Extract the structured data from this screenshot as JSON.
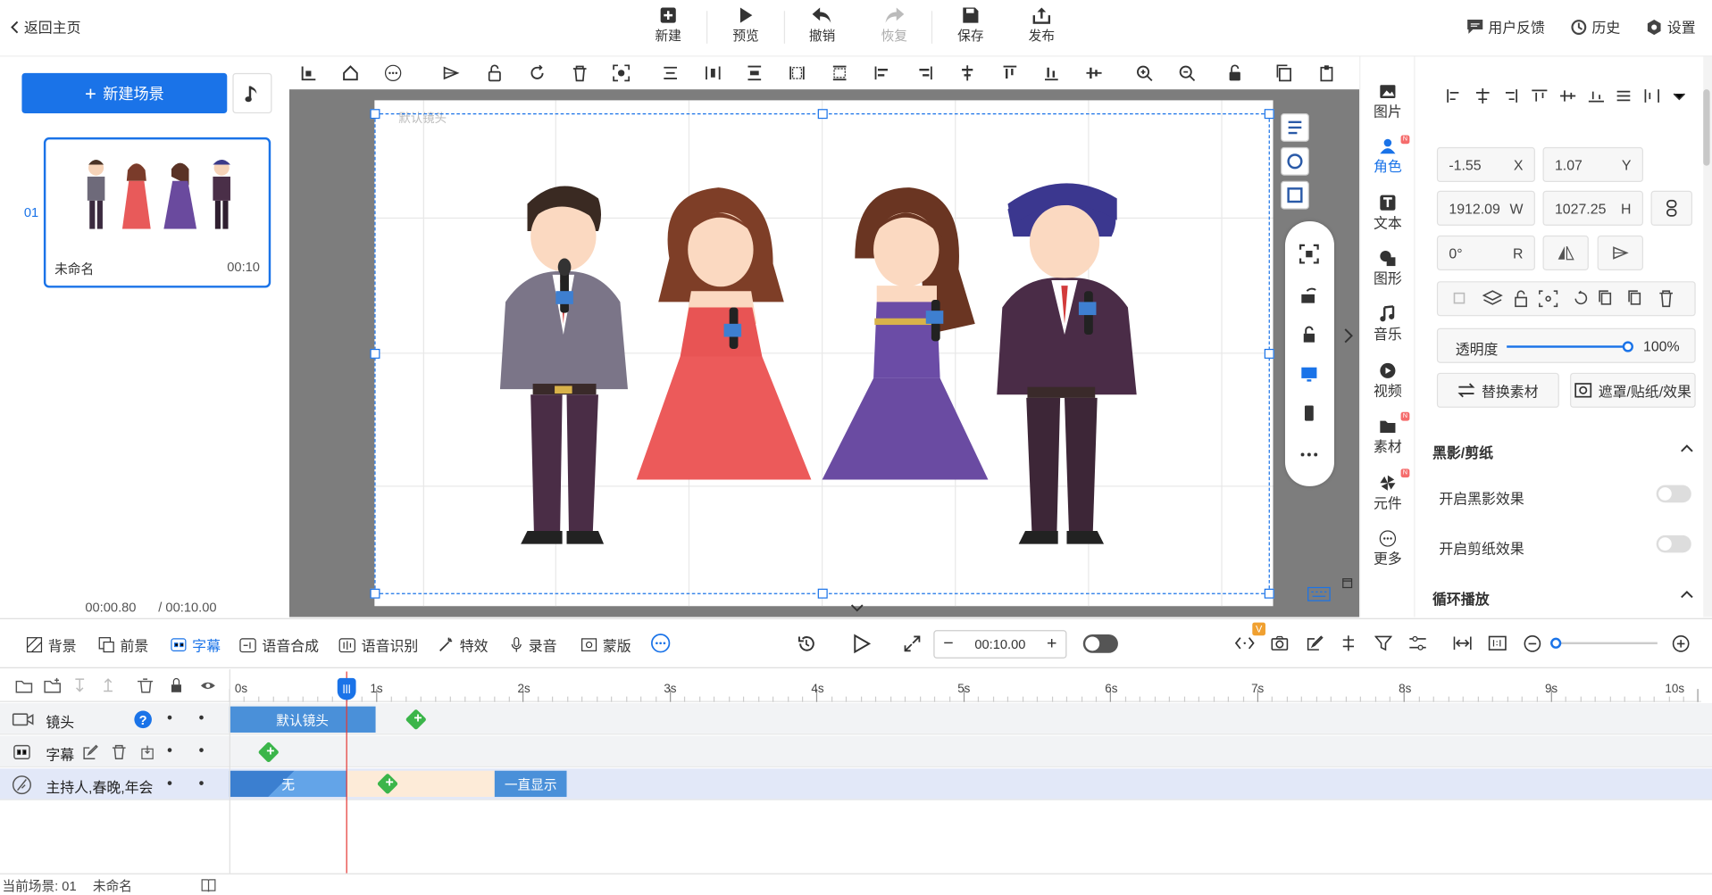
{
  "topbar": {
    "back_label": "返回主页",
    "new_label": "新建",
    "preview_label": "预览",
    "undo_label": "撤销",
    "redo_label": "恢复",
    "save_label": "保存",
    "publish_label": "发布",
    "feedback_label": "用户反馈",
    "history_label": "历史",
    "settings_label": "设置"
  },
  "left": {
    "new_scene_label": "新建场景",
    "scene_index": "01",
    "scene_name": "未命名",
    "scene_duration": "00:10",
    "current_time": "00:00.80",
    "total_time": "/ 00:10.00"
  },
  "canvas": {
    "camera_label": "默认镜头"
  },
  "rnav": {
    "items": [
      {
        "label": "图片",
        "icon": "image-icon"
      },
      {
        "label": "角色",
        "icon": "person-icon"
      },
      {
        "label": "文本",
        "icon": "text-icon"
      },
      {
        "label": "图形",
        "icon": "shape-icon"
      },
      {
        "label": "音乐",
        "icon": "music-icon"
      },
      {
        "label": "视频",
        "icon": "video-icon"
      },
      {
        "label": "素材",
        "icon": "folder-icon"
      },
      {
        "label": "元件",
        "icon": "pinwheel-icon"
      },
      {
        "label": "更多",
        "icon": "more-icon"
      }
    ],
    "badge": "N"
  },
  "props": {
    "x_value": "-1.55",
    "x_label": "X",
    "y_value": "1.07",
    "y_label": "Y",
    "w_value": "1912.09",
    "w_label": "W",
    "h_value": "1027.25",
    "h_label": "H",
    "r_value": "0°",
    "r_label": "R",
    "opacity_label": "透明度",
    "opacity_value": "100%",
    "opacity_level": 1.0,
    "replace_label": "替换素材",
    "mask_label": "遮罩/贴纸/效果",
    "section_shadow": "黑影/剪纸",
    "shadow_toggle_label": "开启黑影效果",
    "paper_toggle_label": "开启剪纸效果",
    "section_loop": "循环播放"
  },
  "timeline_toolbar": {
    "bg": "背景",
    "fg": "前景",
    "subtitle": "字幕",
    "tts": "语音合成",
    "asr": "语音识别",
    "effects": "特效",
    "record": "录音",
    "mask": "蒙版",
    "time": "00:10.00",
    "vip_badge": "V"
  },
  "ruler": [
    "0s",
    "1s",
    "2s",
    "3s",
    "4s",
    "5s",
    "6s",
    "7s",
    "8s",
    "9s",
    "10s"
  ],
  "tracks": {
    "camera_name": "镜头",
    "camera_clip": "默认镜头",
    "subtitle_name": "字幕",
    "role_name": "主持人,春晚,年会",
    "role_clip_a": "无",
    "role_clip_b": "一直显示"
  },
  "status": {
    "current_scene": "当前场景: 01",
    "scene_name": "未命名"
  },
  "colors": {
    "accent": "#1a73e8",
    "keyframe": "#3bb54a",
    "canvas_bg": "#7d7d7d"
  }
}
